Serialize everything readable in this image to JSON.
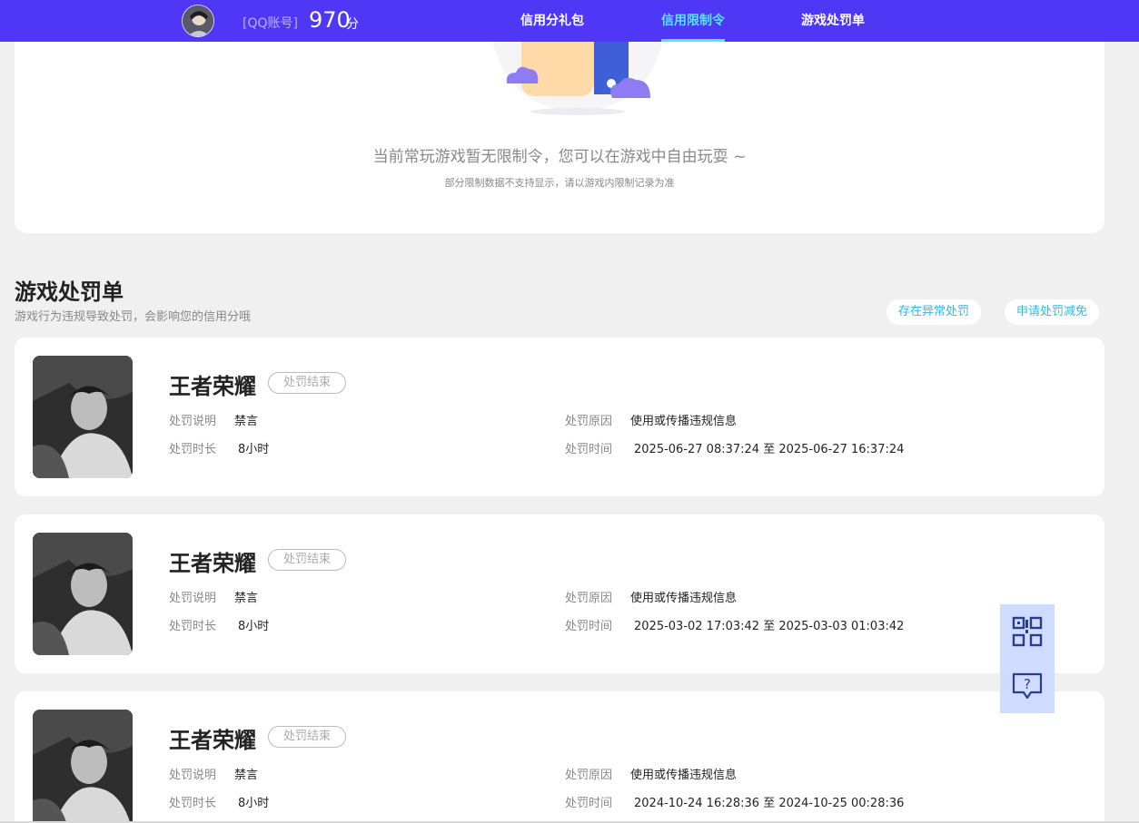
{
  "header": {
    "account_type": "[QQ账号]",
    "score": "970",
    "score_unit": "分",
    "nav": [
      {
        "label": "信用分礼包",
        "active": false
      },
      {
        "label": "信用限制令",
        "active": true
      },
      {
        "label": "游戏处罚单",
        "active": false
      }
    ],
    "accent": "#4f37f5"
  },
  "restriction": {
    "empty_title": "当前常玩游戏暂无限制令，您可以在游戏中自由玩耍 ~",
    "empty_sub": "部分限制数据不支持显示，请以游戏内限制记录为准"
  },
  "penalty": {
    "title": "游戏处罚单",
    "subtitle": "游戏行为违规导致处罚，会影响您的信用分哦",
    "btn_abnormal": "存在异常处罚",
    "btn_appeal": "申请处罚减免",
    "labels": {
      "desc": "处罚说明",
      "duration": "处罚时长",
      "reason": "处罚原因",
      "time": "处罚时间"
    },
    "items": [
      {
        "game": "王者荣耀",
        "status": "处罚结束",
        "desc": "禁言",
        "duration": "8小时",
        "reason": "使用或传播违规信息",
        "time": "2025-06-27 08:37:24 至 2025-06-27 16:37:24"
      },
      {
        "game": "王者荣耀",
        "status": "处罚结束",
        "desc": "禁言",
        "duration": "8小时",
        "reason": "使用或传播违规信息",
        "time": "2025-03-02 17:03:42 至 2025-03-03 01:03:42"
      },
      {
        "game": "王者荣耀",
        "status": "处罚结束",
        "desc": "禁言",
        "duration": "8小时",
        "reason": "使用或传播违规信息",
        "time": "2024-10-24 16:28:36 至 2024-10-25 00:28:36"
      }
    ]
  },
  "float": {
    "qr_icon": "qr-code-icon",
    "help_icon": "help-chat-icon"
  }
}
